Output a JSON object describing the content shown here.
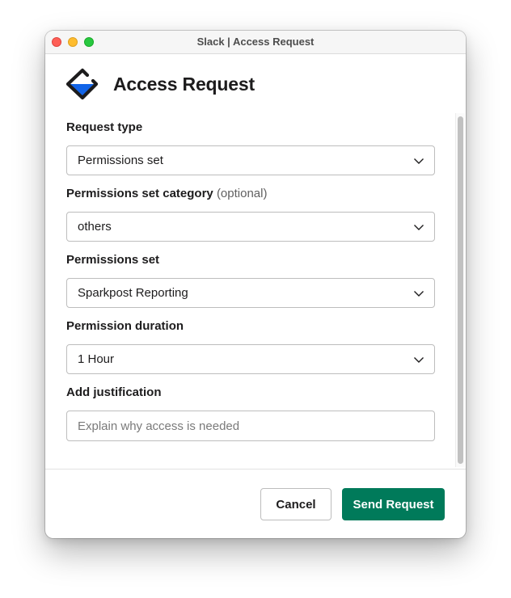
{
  "window": {
    "title": "Slack | Access Request",
    "controls": [
      "close",
      "minimize",
      "maximize"
    ]
  },
  "header": {
    "logo_icon": "access-request-logo-icon",
    "title": "Access Request"
  },
  "form": {
    "request_type": {
      "label": "Request type",
      "value": "Permissions set"
    },
    "category": {
      "label": "Permissions set category",
      "optional_label": "(optional)",
      "value": "others"
    },
    "permissions_set": {
      "label": "Permissions set",
      "value": "Sparkpost Reporting"
    },
    "duration": {
      "label": "Permission duration",
      "value": "1 Hour"
    },
    "justification": {
      "label": "Add justification",
      "value": "",
      "placeholder": "Explain why access is needed"
    }
  },
  "footer": {
    "cancel_label": "Cancel",
    "submit_label": "Send Request"
  },
  "colors": {
    "primary_button": "#007a5a",
    "logo_blue": "#1264e8",
    "logo_dark": "#1d1c1d"
  }
}
